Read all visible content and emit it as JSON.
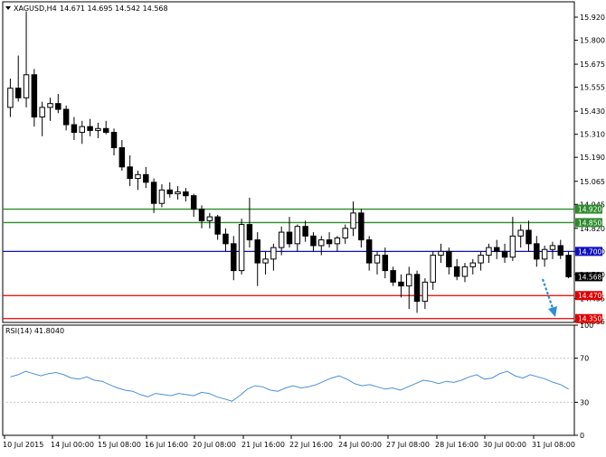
{
  "header": {
    "symbol": "XAGUSD,H4",
    "ohlc": "14.671 14.695 14.542 14.568"
  },
  "colors": {
    "level_green": "#2e8b2e",
    "level_blue": "#1010c0",
    "level_red": "#e00000",
    "current_price_bg": "#000000",
    "rsi_line": "#4a8fd6",
    "arrow": "#2d8fd6",
    "grid": "#c8c8c8"
  },
  "chart_data": [
    {
      "type": "candlestick",
      "title": "XAGUSD,H4",
      "ylim": [
        14.33,
        16.0
      ],
      "y_ticks": [
        "15.920",
        "15.800",
        "15.675",
        "15.555",
        "15.430",
        "15.310",
        "15.190",
        "15.065",
        "14.945",
        "14.820",
        "14.700",
        "14.580",
        "14.455",
        "14.335"
      ],
      "x_ticks": [
        "10 Jul 2015",
        "14 Jul 00:00",
        "15 Jul 08:00",
        "16 Jul 16:00",
        "20 Jul 08:00",
        "21 Jul 16:00",
        "22 Jul 16:00",
        "24 Jul 00:00",
        "27 Jul 08:00",
        "28 Jul 16:00",
        "30 Jul 00:00",
        "31 Jul 08:00"
      ],
      "levels": [
        {
          "label": "14.920",
          "value": 14.92,
          "color": "green"
        },
        {
          "label": "14.850",
          "value": 14.85,
          "color": "green"
        },
        {
          "label": "14.700",
          "value": 14.7,
          "color": "blue"
        },
        {
          "label": "14.470",
          "value": 14.47,
          "color": "red"
        },
        {
          "label": "14.350",
          "value": 14.35,
          "color": "red"
        }
      ],
      "current_price": {
        "label": "14.568",
        "value": 14.568
      },
      "candles": [
        [
          15.45,
          15.6,
          15.4,
          15.55
        ],
        [
          15.55,
          15.72,
          15.48,
          15.5
        ],
        [
          15.5,
          15.95,
          15.45,
          15.62
        ],
        [
          15.62,
          15.65,
          15.35,
          15.4
        ],
        [
          15.4,
          15.48,
          15.3,
          15.45
        ],
        [
          15.45,
          15.5,
          15.38,
          15.47
        ],
        [
          15.47,
          15.52,
          15.42,
          15.44
        ],
        [
          15.44,
          15.46,
          15.33,
          15.36
        ],
        [
          15.36,
          15.4,
          15.28,
          15.32
        ],
        [
          15.32,
          15.38,
          15.26,
          15.35
        ],
        [
          15.35,
          15.39,
          15.3,
          15.33
        ],
        [
          15.33,
          15.37,
          15.29,
          15.34
        ],
        [
          15.34,
          15.38,
          15.31,
          15.32
        ],
        [
          15.32,
          15.34,
          15.2,
          15.24
        ],
        [
          15.24,
          15.28,
          15.12,
          15.14
        ],
        [
          15.14,
          15.2,
          15.04,
          15.08
        ],
        [
          15.08,
          15.12,
          15.02,
          15.1
        ],
        [
          15.1,
          15.14,
          15.03,
          15.06
        ],
        [
          15.06,
          15.08,
          14.9,
          14.95
        ],
        [
          14.95,
          15.05,
          14.93,
          15.02
        ],
        [
          15.02,
          15.06,
          14.98,
          15.0
        ],
        [
          15.0,
          15.04,
          14.97,
          15.01
        ],
        [
          15.01,
          15.03,
          14.96,
          14.99
        ],
        [
          14.99,
          15.0,
          14.88,
          14.92
        ],
        [
          14.92,
          14.94,
          14.82,
          14.86
        ],
        [
          14.86,
          14.9,
          14.82,
          14.88
        ],
        [
          14.88,
          14.89,
          14.76,
          14.79
        ],
        [
          14.79,
          14.82,
          14.7,
          14.74
        ],
        [
          14.74,
          14.78,
          14.55,
          14.6
        ],
        [
          14.6,
          14.87,
          14.58,
          14.84
        ],
        [
          14.84,
          14.98,
          14.72,
          14.76
        ],
        [
          14.76,
          14.8,
          14.52,
          14.64
        ],
        [
          14.64,
          14.7,
          14.58,
          14.66
        ],
        [
          14.66,
          14.74,
          14.6,
          14.72
        ],
        [
          14.72,
          14.83,
          14.68,
          14.8
        ],
        [
          14.8,
          14.88,
          14.72,
          14.74
        ],
        [
          14.74,
          14.84,
          14.7,
          14.83
        ],
        [
          14.83,
          14.86,
          14.75,
          14.78
        ],
        [
          14.78,
          14.8,
          14.7,
          14.73
        ],
        [
          14.73,
          14.78,
          14.68,
          14.76
        ],
        [
          14.76,
          14.8,
          14.72,
          14.74
        ],
        [
          14.74,
          14.78,
          14.7,
          14.77
        ],
        [
          14.77,
          14.84,
          14.74,
          14.82
        ],
        [
          14.82,
          14.96,
          14.78,
          14.9
        ],
        [
          14.9,
          14.92,
          14.72,
          14.76
        ],
        [
          14.76,
          14.78,
          14.6,
          14.64
        ],
        [
          14.64,
          14.7,
          14.58,
          14.68
        ],
        [
          14.68,
          14.72,
          14.56,
          14.6
        ],
        [
          14.6,
          14.62,
          14.52,
          14.54
        ],
        [
          14.54,
          14.58,
          14.46,
          14.52
        ],
        [
          14.52,
          14.62,
          14.4,
          14.58
        ],
        [
          14.58,
          14.6,
          14.38,
          14.44
        ],
        [
          14.44,
          14.56,
          14.4,
          14.54
        ],
        [
          14.54,
          14.7,
          14.5,
          14.68
        ],
        [
          14.68,
          14.74,
          14.64,
          14.7
        ],
        [
          14.7,
          14.72,
          14.58,
          14.62
        ],
        [
          14.62,
          14.66,
          14.55,
          14.57
        ],
        [
          14.57,
          14.64,
          14.54,
          14.62
        ],
        [
          14.62,
          14.66,
          14.58,
          14.64
        ],
        [
          14.64,
          14.7,
          14.6,
          14.68
        ],
        [
          14.68,
          14.74,
          14.64,
          14.72
        ],
        [
          14.72,
          14.76,
          14.66,
          14.7
        ],
        [
          14.7,
          14.74,
          14.64,
          14.67
        ],
        [
          14.67,
          14.88,
          14.65,
          14.78
        ],
        [
          14.78,
          14.84,
          14.72,
          14.81
        ],
        [
          14.81,
          14.86,
          14.7,
          14.74
        ],
        [
          14.74,
          14.78,
          14.62,
          14.66
        ],
        [
          14.66,
          14.73,
          14.62,
          14.71
        ],
        [
          14.71,
          14.75,
          14.66,
          14.73
        ],
        [
          14.73,
          14.76,
          14.66,
          14.68
        ],
        [
          14.68,
          14.7,
          14.56,
          14.568
        ]
      ]
    },
    {
      "type": "line",
      "title": "RSI(14) 41.8040",
      "ylim": [
        0,
        100
      ],
      "y_ticks": [
        "100",
        "70",
        "30",
        "0"
      ],
      "values": [
        53,
        55,
        58,
        56,
        54,
        56,
        57,
        55,
        52,
        51,
        53,
        50,
        49,
        46,
        43,
        41,
        40,
        37,
        35,
        38,
        37,
        36,
        38,
        37,
        36,
        39,
        38,
        35,
        33,
        31,
        36,
        42,
        45,
        44,
        41,
        40,
        43,
        45,
        43,
        44,
        46,
        49,
        52,
        54,
        51,
        47,
        45,
        46,
        44,
        42,
        43,
        41,
        44,
        47,
        50,
        49,
        47,
        49,
        48,
        50,
        53,
        55,
        51,
        52,
        56,
        58,
        54,
        52,
        55,
        53,
        51,
        48,
        46,
        42
      ]
    }
  ]
}
